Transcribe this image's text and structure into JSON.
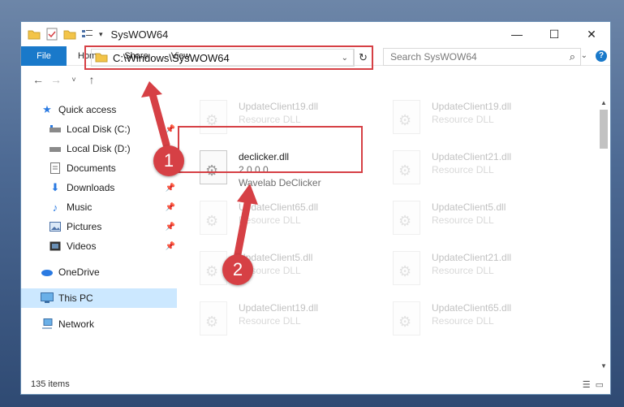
{
  "window": {
    "title": "SysWOW64",
    "controls": {
      "minimize": "—",
      "maximize": "☐",
      "close": "✕"
    }
  },
  "ribbon": {
    "tabs": [
      "File",
      "Home",
      "Share",
      "View"
    ],
    "help": "?"
  },
  "address": {
    "path": "C:\\Windows\\SysWOW64",
    "search_placeholder": "Search SysWOW64"
  },
  "sidebar": {
    "items": [
      {
        "label": "Quick access",
        "icon": "star-icon",
        "level": 0
      },
      {
        "label": "Local Disk (C:)",
        "icon": "drive-icon",
        "level": 1,
        "pinned": true
      },
      {
        "label": "Local Disk (D:)",
        "icon": "drive-icon",
        "level": 1
      },
      {
        "label": "Documents",
        "icon": "document-icon",
        "level": 1,
        "pinned": true
      },
      {
        "label": "Downloads",
        "icon": "download-icon",
        "level": 1,
        "pinned": true
      },
      {
        "label": "Music",
        "icon": "music-icon",
        "level": 1,
        "pinned": true
      },
      {
        "label": "Pictures",
        "icon": "pictures-icon",
        "level": 1,
        "pinned": true
      },
      {
        "label": "Videos",
        "icon": "video-icon",
        "level": 1,
        "pinned": true
      },
      {
        "label": "OneDrive",
        "icon": "cloud-icon",
        "level": 0
      },
      {
        "label": "This PC",
        "icon": "computer-icon",
        "level": 0,
        "selected": true
      },
      {
        "label": "Network",
        "icon": "network-icon",
        "level": 0
      }
    ]
  },
  "files": [
    {
      "name": "UpdateClient19.dll",
      "sub": "Resource DLL",
      "faded": true
    },
    {
      "name": "UpdateClient19.dll",
      "sub": "Resource DLL",
      "faded": true
    },
    {
      "name": "declicker.dll",
      "version": "2.0.0.0",
      "sub": "Wavelab DeClicker",
      "faded": false
    },
    {
      "name": "UpdateClient21.dll",
      "sub": "Resource DLL",
      "faded": true
    },
    {
      "name": "UpdateClient65.dll",
      "sub": "Resource DLL",
      "faded": true
    },
    {
      "name": "UpdateClient5.dll",
      "sub": "Resource DLL",
      "faded": true
    },
    {
      "name": "UpdateClient5.dll",
      "sub": "Resource DLL",
      "faded": true
    },
    {
      "name": "UpdateClient21.dll",
      "sub": "Resource DLL",
      "faded": true
    },
    {
      "name": "UpdateClient19.dll",
      "sub": "Resource DLL",
      "faded": true
    },
    {
      "name": "UpdateClient65.dll",
      "sub": "Resource DLL",
      "faded": true
    }
  ],
  "status": {
    "count": "135 items"
  },
  "annotations": {
    "step1": "1",
    "step2": "2",
    "color": "#d64045"
  }
}
